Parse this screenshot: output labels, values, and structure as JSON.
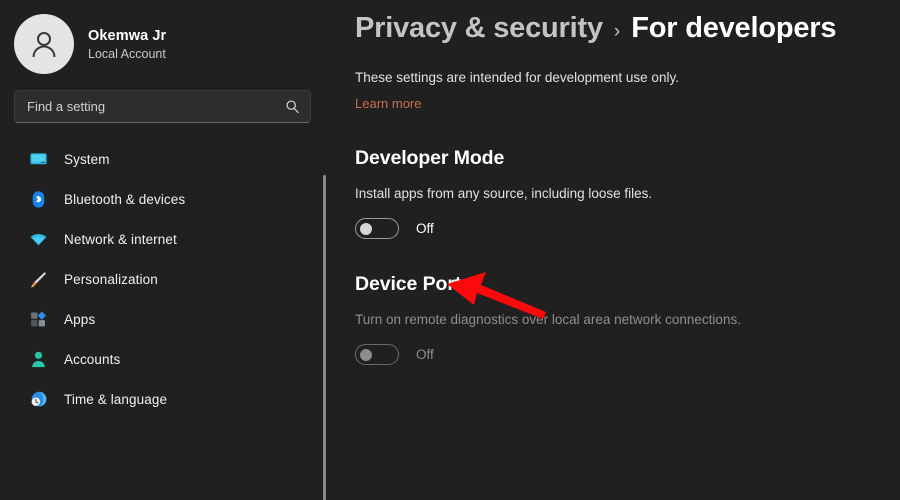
{
  "sidebar": {
    "profile": {
      "avatar_icon": "person-avatar-icon",
      "name": "Okemwa Jr",
      "account_type": "Local Account"
    },
    "search": {
      "placeholder": "Find a setting",
      "value": "",
      "icon": "search-icon"
    },
    "items": [
      {
        "label": "System",
        "icon": "monitor-icon"
      },
      {
        "label": "Bluetooth & devices",
        "icon": "bluetooth-icon"
      },
      {
        "label": "Network & internet",
        "icon": "wifi-icon"
      },
      {
        "label": "Personalization",
        "icon": "paintbrush-icon"
      },
      {
        "label": "Apps",
        "icon": "apps-grid-icon"
      },
      {
        "label": "Accounts",
        "icon": "person-icon"
      },
      {
        "label": "Time & language",
        "icon": "clock-globe-icon"
      }
    ]
  },
  "header": {
    "breadcrumb_parent": "Privacy & security",
    "breadcrumb_separator": "›",
    "breadcrumb_current": "For developers",
    "intro": "These settings are intended for development use only.",
    "learn_more": "Learn more"
  },
  "sections": [
    {
      "title": "Developer Mode",
      "description": "Install apps from any source, including loose files.",
      "toggle_state": "Off",
      "enabled": true
    },
    {
      "title": "Device Portal",
      "description": "Turn on remote diagnostics over local area network connections.",
      "toggle_state": "Off",
      "enabled": false
    }
  ],
  "annotation": {
    "arrow_icon": "red-arrow-pointing-left",
    "color": "#fa0a0a"
  },
  "colors": {
    "background": "#202020",
    "accent_link": "#c5704f",
    "annotation_red": "#fa0a0a",
    "text_primary": "#ffffff",
    "text_secondary": "#c8c8c8",
    "text_disabled": "#8e8e8e"
  }
}
